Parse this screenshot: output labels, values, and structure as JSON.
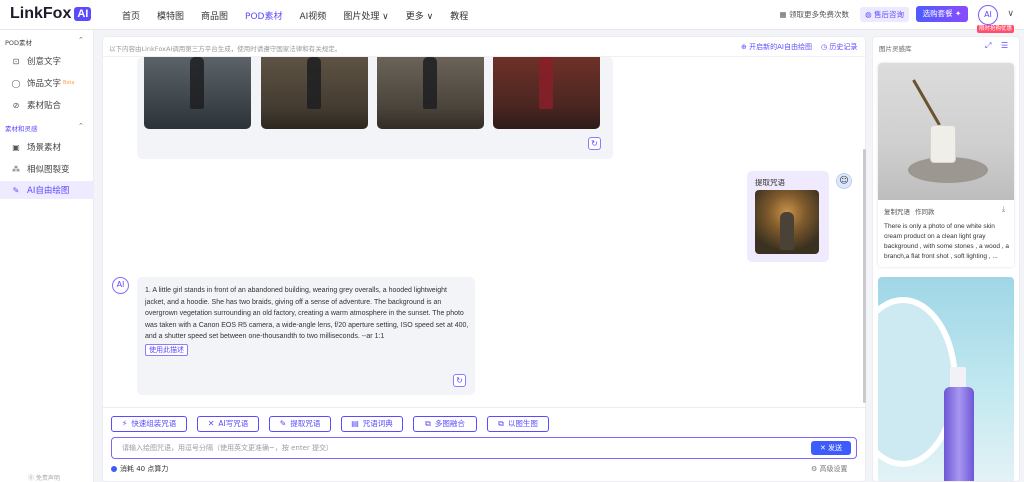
{
  "header": {
    "logo_text": "LinkFox",
    "logo_badge": "AI",
    "nav": [
      {
        "label": "首页",
        "active": false
      },
      {
        "label": "模特图",
        "active": false
      },
      {
        "label": "商品图",
        "active": false
      },
      {
        "label": "POD素材",
        "active": true
      },
      {
        "label": "AI视频",
        "active": false
      },
      {
        "label": "图片处理 ∨",
        "active": false
      },
      {
        "label": "更多 ∨",
        "active": false
      },
      {
        "label": "教程",
        "active": false
      }
    ],
    "coupon": "领取更多免费次数",
    "consult": "售后咨询",
    "package": "选购套餐",
    "avatar": "AI",
    "user_tag": "限时抢购优惠"
  },
  "sidebar": {
    "section1": "POD素材",
    "section2": "素材和灵感",
    "items1": [
      {
        "label": "创意文字",
        "icon": "text-icon"
      },
      {
        "label": "饰品文字",
        "icon": "ring-icon",
        "badge": "Beta"
      },
      {
        "label": "素材贴合",
        "icon": "fit-icon"
      }
    ],
    "items2": [
      {
        "label": "场景素材",
        "icon": "image-icon"
      },
      {
        "label": "相似图裂变",
        "icon": "split-icon"
      },
      {
        "label": "AI自由绘图",
        "icon": "draw-icon",
        "active": true
      }
    ],
    "footer": "⓪ 免责声明"
  },
  "main": {
    "notice": "以下内容由LinkFoxAI调用第三方平台生成，使用时请遵守国家法律和有关规定。",
    "new_chat": "开启新的AI自由绘图",
    "history": "历史记录",
    "user_message_title": "提取咒语",
    "response_text": "1. A little girl stands in front of an abandoned building, wearing grey overalls, a hooded lightweight jacket, and a hoodie. She has two braids, giving off a sense of adventure. The background is an overgrown vegetation surrounding an old factory, creating a warm atmosphere in the sunset. The photo was taken with a Canon EOS R5 camera, a wide-angle lens, f/20 aperture setting, ISO speed set at 400, and a shutter speed set between one-thousandth to two milliseconds. --ar 1:1",
    "use_button": "使用此描述",
    "toolbar": [
      {
        "label": "快速组装咒语",
        "icon": "wand-icon"
      },
      {
        "label": "AI写咒语",
        "icon": "ai-write-icon"
      },
      {
        "label": "提取咒语",
        "icon": "extract-icon"
      },
      {
        "label": "咒语词典",
        "icon": "dictionary-icon"
      },
      {
        "label": "多图融合",
        "icon": "merge-icon"
      },
      {
        "label": "以图生图",
        "icon": "img2img-icon"
      }
    ],
    "input_placeholder": "请输入绘图咒语，用逗号分隔（使用英文更准确~，按 enter 提交）",
    "send": "发送",
    "cost": "消耗 40 点算力",
    "advanced": "高级设置"
  },
  "right_panel": {
    "title": "图片灵感库",
    "card_actions": [
      "复制咒语",
      "作同款"
    ],
    "card_desc": "There is only a photo of one white skin cream product on a clean light gray background , with some stones , a wood , a branch,a flat front shot , soft lighting , ..."
  },
  "colors": {
    "accent": "#5b4bff",
    "send": "#3d5bff",
    "tag": "#ff4d6a"
  }
}
